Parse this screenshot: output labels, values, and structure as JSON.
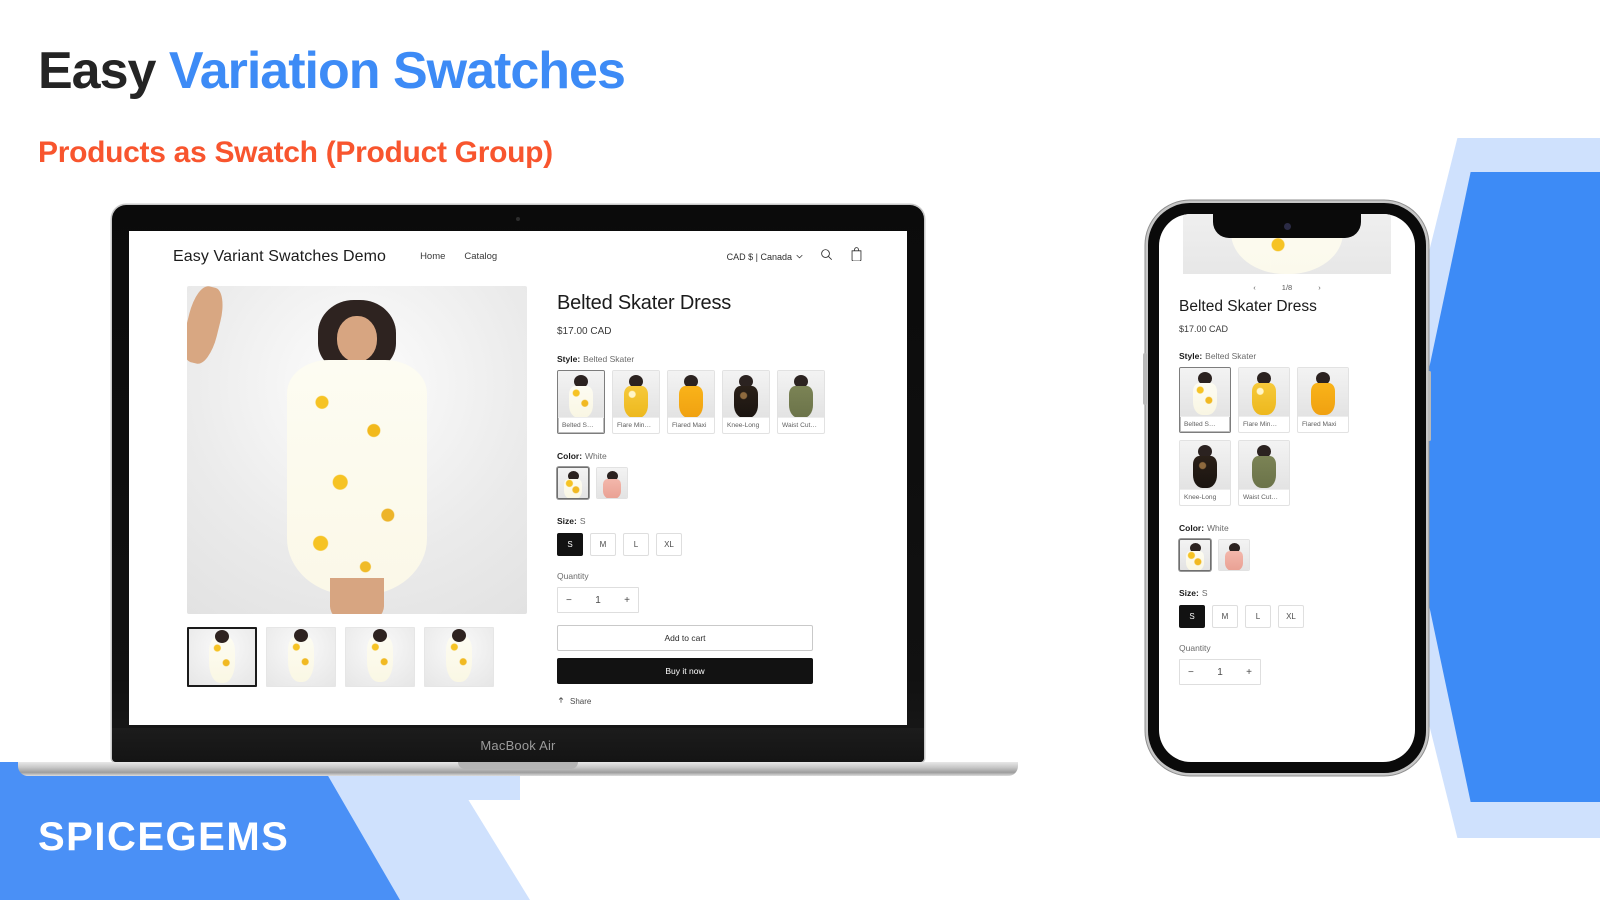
{
  "heading": {
    "title_part1": "Easy ",
    "title_part2": "Variation Swatches",
    "subtitle": "Products as Swatch (Product Group)"
  },
  "brand": {
    "name": "SPICEGEMS"
  },
  "colors": {
    "accent_blue": "#3d8bf6",
    "accent_orange": "#f8552e",
    "title_dark": "#242424",
    "light_blue": "#cfe1fd",
    "button_black": "#121212"
  },
  "laptop": {
    "model_label": "MacBook Air"
  },
  "store": {
    "logo": "Easy Variant Swatches Demo",
    "nav": [
      {
        "label": "Home"
      },
      {
        "label": "Catalog"
      }
    ],
    "currency_selector": "CAD $ | Canada",
    "icons": {
      "chevron": "chevron-down-icon",
      "search": "search-icon",
      "cart": "cart-icon"
    }
  },
  "product": {
    "title": "Belted Skater Dress",
    "price": "$17.00 CAD",
    "style": {
      "label": "Style:",
      "value": "Belted Skater",
      "options": [
        {
          "caption": "Belted S…",
          "selected": true,
          "swatch": "b-white"
        },
        {
          "caption": "Flare Min…",
          "selected": false,
          "swatch": "b-yellow"
        },
        {
          "caption": "Flared Maxi",
          "selected": false,
          "swatch": "b-orange"
        },
        {
          "caption": "Knee-Long",
          "selected": false,
          "swatch": "b-black"
        },
        {
          "caption": "Waist Cut…",
          "selected": false,
          "swatch": "b-olive"
        }
      ]
    },
    "color": {
      "label": "Color:",
      "value": "White",
      "options": [
        {
          "name": "White",
          "selected": true,
          "swatch": "b-white"
        },
        {
          "name": "Pink",
          "selected": false,
          "swatch": "b-pink"
        }
      ]
    },
    "size": {
      "label": "Size:",
      "value": "S",
      "options": [
        {
          "label": "S",
          "selected": true
        },
        {
          "label": "M",
          "selected": false
        },
        {
          "label": "L",
          "selected": false
        },
        {
          "label": "XL",
          "selected": false
        }
      ]
    },
    "quantity": {
      "label": "Quantity",
      "value": "1",
      "minus": "−",
      "plus": "+"
    },
    "actions": {
      "add_to_cart": "Add to cart",
      "buy_it_now": "Buy it now",
      "share": "Share"
    },
    "gallery": {
      "thumbs": [
        {
          "selected": true
        },
        {
          "selected": false
        },
        {
          "selected": false
        },
        {
          "selected": false
        }
      ]
    }
  },
  "mobile": {
    "carousel": {
      "prev": "‹",
      "counter": "1/8",
      "next": "›"
    }
  }
}
